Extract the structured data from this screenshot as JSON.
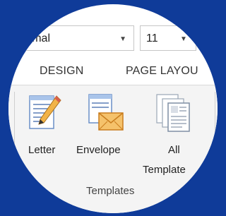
{
  "font_style_select": {
    "value": "ormal"
  },
  "font_size_select": {
    "value": "11"
  },
  "tabs": [
    {
      "label": "DESIGN"
    },
    {
      "label": "PAGE LAYOU"
    }
  ],
  "templates_group": {
    "label": "Templates",
    "buttons": [
      {
        "label": "Letter",
        "icon": "letter-pencil-icon"
      },
      {
        "label": "Envelope",
        "icon": "envelope-icon"
      },
      {
        "label_line1": "All",
        "label_line2": "Template",
        "icon": "all-templates-icon"
      }
    ]
  },
  "colors": {
    "background": "#0f3b99",
    "ribbon": "#f4f4f4",
    "envelope_orange": "#f0a233"
  }
}
